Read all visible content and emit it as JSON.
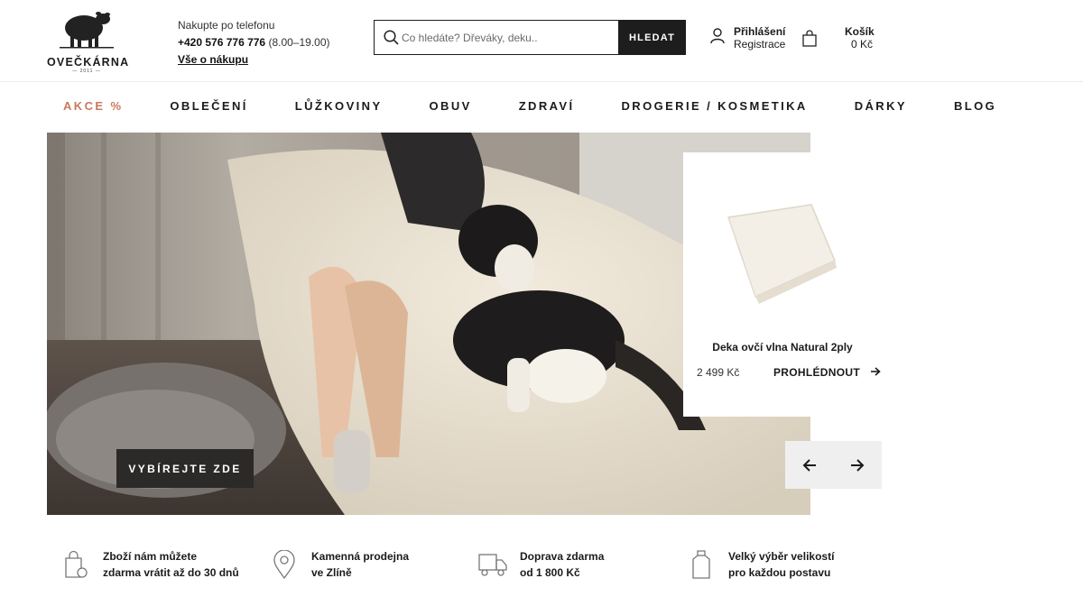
{
  "brand": {
    "name": "OVEČKÁRNA",
    "year": "— 2011 —"
  },
  "contact": {
    "label": "Nakupte po telefonu",
    "phone": "+420 576 776 776",
    "hours": "(8.00–19.00)",
    "link": "Vše o nákupu"
  },
  "search": {
    "placeholder": "Co hledáte? Dřeváky, deku..",
    "button": "HLEDAT"
  },
  "account": {
    "login": "Přihlášení",
    "register": "Registrace"
  },
  "cart": {
    "label": "Košík",
    "total": "0 Kč"
  },
  "nav": [
    "AKCE %",
    "OBLEČENÍ",
    "LŮŽKOVINY",
    "OBUV",
    "ZDRAVÍ",
    "DROGERIE / KOSMETIKA",
    "DÁRKY",
    "BLOG"
  ],
  "hero": {
    "button": "VYBÍREJTE ZDE"
  },
  "product_card": {
    "name": "Deka ovčí vlna Natural 2ply",
    "price": "2 499 Kč",
    "action": "PROHLÉDNOUT"
  },
  "benefits": [
    {
      "icon": "return-bag-icon",
      "line1": "Zboží nám můžete",
      "line2": "zdarma vrátit až do 30 dnů"
    },
    {
      "icon": "location-pin-icon",
      "line1": "Kamenná prodejna",
      "line2": "ve Zlíně"
    },
    {
      "icon": "truck-icon",
      "line1": "Doprava zdarma",
      "line2": "od 1 800 Kč"
    },
    {
      "icon": "shirt-size-icon",
      "line1": "Velký výběr velikostí",
      "line2": "pro každou postavu"
    }
  ],
  "colors": {
    "sale": "#c9795f",
    "dark": "#1d1d1d",
    "button_dark": "#2b2a29"
  }
}
